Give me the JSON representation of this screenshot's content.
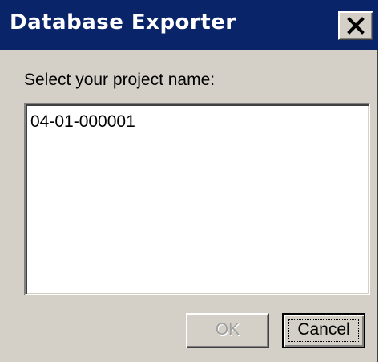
{
  "window": {
    "title": "Database Exporter"
  },
  "prompt": {
    "label": "Select your project name:"
  },
  "project_list": {
    "items": [
      "04-01-000001"
    ]
  },
  "buttons": {
    "ok_label": "OK",
    "cancel_label": "Cancel"
  },
  "colors": {
    "titlebar": "#0a246a",
    "window_face": "#d4d0c8",
    "disabled_text": "#a0a0a0"
  },
  "icons": {
    "close": "close-icon"
  }
}
